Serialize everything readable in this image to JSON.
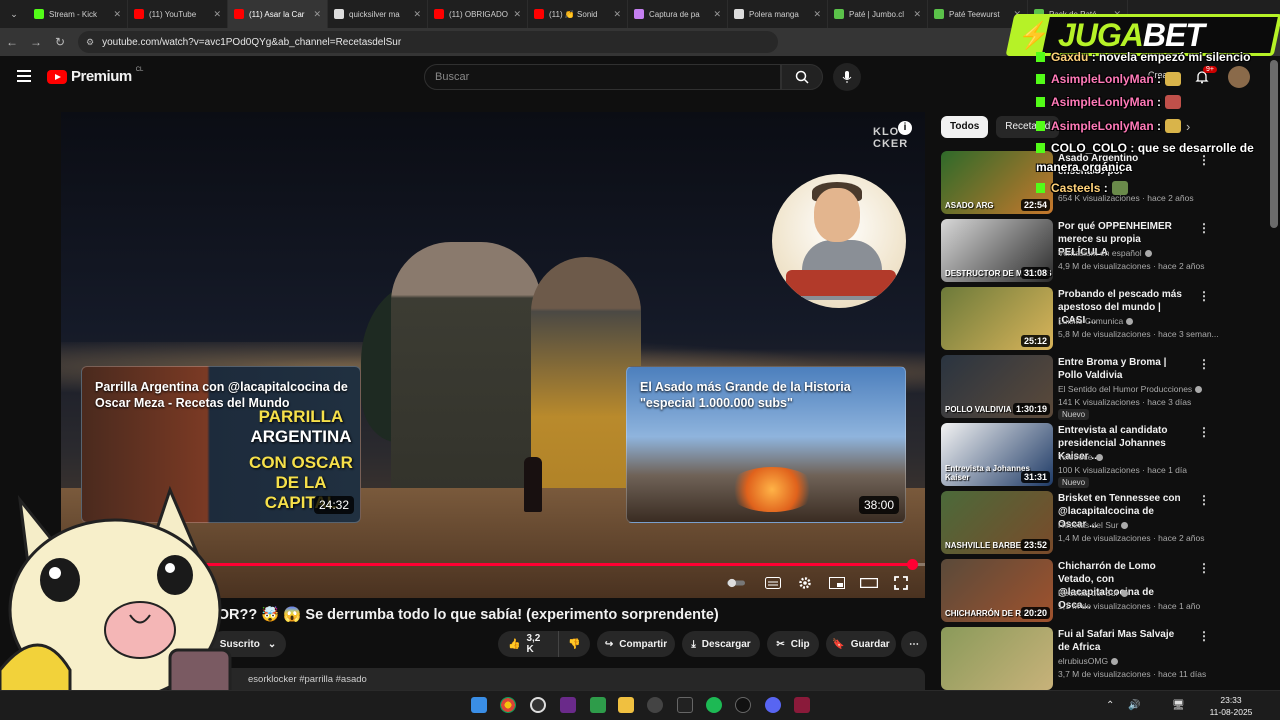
{
  "browser": {
    "tabs": [
      {
        "label": "Stream - Kick",
        "color": "#53fc18"
      },
      {
        "label": "(11) YouTube",
        "color": "#ff0000"
      },
      {
        "label": "(11) Asar la Car",
        "color": "#ff0000",
        "active": true
      },
      {
        "label": "quicksilver ma",
        "color": "#dddddd"
      },
      {
        "label": "(11) OBRIGADO",
        "color": "#ff0000"
      },
      {
        "label": "(11) 👏 Sonid",
        "color": "#ff0000"
      },
      {
        "label": "Captura de pa",
        "color": "#c47ff0"
      },
      {
        "label": "Polera manga",
        "color": "#dddddd"
      },
      {
        "label": "Paté | Jumbo.cl",
        "color": "#5bc24a"
      },
      {
        "label": "Paté Teewurst",
        "color": "#5bc24a"
      },
      {
        "label": "Pack de Paté",
        "color": "#5bc24a"
      }
    ],
    "url": "youtube.com/watch?v=avc1POd0QYg&ab_channel=RecetasdelSur"
  },
  "youtube": {
    "logo_text": "Premium",
    "country": "CL",
    "search_placeholder": "Buscar",
    "create_label": "Crear",
    "notif_count": "9+"
  },
  "player": {
    "watermark": "KLO\nCKER",
    "info_icon": "i",
    "progress_fraction": 0.985,
    "time_fragment": "6",
    "endcards": [
      {
        "title": "Parrilla Argentina con @lacapitalcocina de Oscar Meza - Recetas del Mundo",
        "thumb_big": [
          "PARRILLA",
          "ARGENTINA",
          "CON OSCAR",
          "DE LA CAPITAL"
        ],
        "duration": "24:32"
      },
      {
        "title": "El Asado más Grande de la Historia \"especial 1.000.000 subs\"",
        "duration": "38:00"
      }
    ]
  },
  "video": {
    "title": "EJOR?? 🤯 😱 Se derrumba todo lo que sabía! (experimento sorprendente)",
    "subscribed_label": "Suscrito",
    "like_count": "3,2 K",
    "share_label": "Compartir",
    "download_label": "Descargar",
    "clip_label": "Clip",
    "save_label": "Guardar",
    "more_label": "⋯",
    "description_snippet": "esorklocker #parrilla #asado"
  },
  "sidebar": {
    "chips": [
      "Todos",
      "Recetas d"
    ],
    "recommendations": [
      {
        "title": "Asado Argentino enseñado por",
        "channel": "",
        "meta": "654 K visualizaciones · hace 2 años",
        "duration": "22:54",
        "thumb_text": "ASADO ARG",
        "colors": [
          "#2e6a2a",
          "#c7782c"
        ]
      },
      {
        "title": "Por qué OPPENHEIMER merece su propia PELÍCULA",
        "channel": "Veritasium en español",
        "meta": "4,9 M de visualizaciones · hace 2 años",
        "duration": "31:08",
        "thumb_text": "DESTRUCTOR DE MUNDOS",
        "colors": [
          "#d8d8d8",
          "#2b2b2b"
        ]
      },
      {
        "title": "Probando el pescado más apestoso del mundo | ¡CASI ...",
        "channel": "Luisito Comunica",
        "meta": "5,8 M de visualizaciones · hace 3 seman...",
        "duration": "25:12",
        "thumb_text": "",
        "colors": [
          "#6c7a3a",
          "#d9b45a"
        ]
      },
      {
        "title": "Entre Broma y Broma | Pollo Valdivia",
        "channel": "El Sentido del Humor Producciones",
        "meta": "141 K visualizaciones · hace 3 días",
        "duration": "1:30:19",
        "badge": "Nuevo",
        "thumb_text": "POLLO VALDIVIA",
        "colors": [
          "#2a3440",
          "#5c4a3a"
        ]
      },
      {
        "title": "Entrevista al candidato presidencial Johannes Kaiser ...",
        "channel": "Teletrece",
        "meta": "100 K visualizaciones · hace 1 día",
        "duration": "31:31",
        "badge": "Nuevo",
        "thumb_text": "Entrevista a Johannes Kaiser",
        "colors": [
          "#f3f3f3",
          "#1e3a66"
        ]
      },
      {
        "title": "Brisket en Tennessee con @lacapitalcocina de Oscar ...",
        "channel": "Recetas del Sur",
        "meta": "1,4 M de visualizaciones · hace 2 años",
        "duration": "23:52",
        "thumb_text": "NASHVILLE BARBE",
        "colors": [
          "#4b6a3a",
          "#7a4a2a"
        ]
      },
      {
        "title": "Chicharrón de Lomo Vetado, con @lacapitalcocina de Osca...",
        "channel": "Recetas del Sur",
        "meta": "1,1 M de visualizaciones · hace 1 año",
        "duration": "20:20",
        "thumb_text": "CHICHARRÓN DE RIB EYE",
        "colors": [
          "#5a4a3a",
          "#a0522d"
        ]
      },
      {
        "title": "Fui al Safari Mas Salvaje de Africa",
        "channel": "elrubiusOMG",
        "meta": "3,7 M de visualizaciones · hace 11 días",
        "duration": "",
        "thumb_text": "",
        "colors": [
          "#8a9a5a",
          "#c8b27a"
        ]
      }
    ]
  },
  "overlay": {
    "sponsor_a": "JUGA",
    "sponsor_b": "BET",
    "chat": [
      {
        "name": "Gaxdu",
        "text": ": novela empezó mi silencio",
        "name_style": "gold"
      },
      {
        "name": "AsimpleLonlyMan",
        "text": ":",
        "name_style": "pink",
        "emote": "#d9b44a"
      },
      {
        "name": "AsimpleLonlyMan",
        "text": ":",
        "name_style": "pink",
        "emote": "#c0504a"
      },
      {
        "name": "AsimpleLonlyMan",
        "text": ":",
        "name_style": "pink",
        "emote": "#d9b44a"
      },
      {
        "name": "COLO_COLO",
        "text": ": que se desarrolle de",
        "name_style": "white"
      },
      {
        "name": "",
        "text": "manera orgánica",
        "name_style": "white"
      },
      {
        "name": "Casteels",
        "text": ":",
        "name_style": "gold",
        "emote": "#6a8a4a"
      }
    ]
  },
  "taskbar": {
    "time": "23:33",
    "date": "11-08-2025",
    "spotify": "spotify",
    "discord_badge": "9+"
  }
}
